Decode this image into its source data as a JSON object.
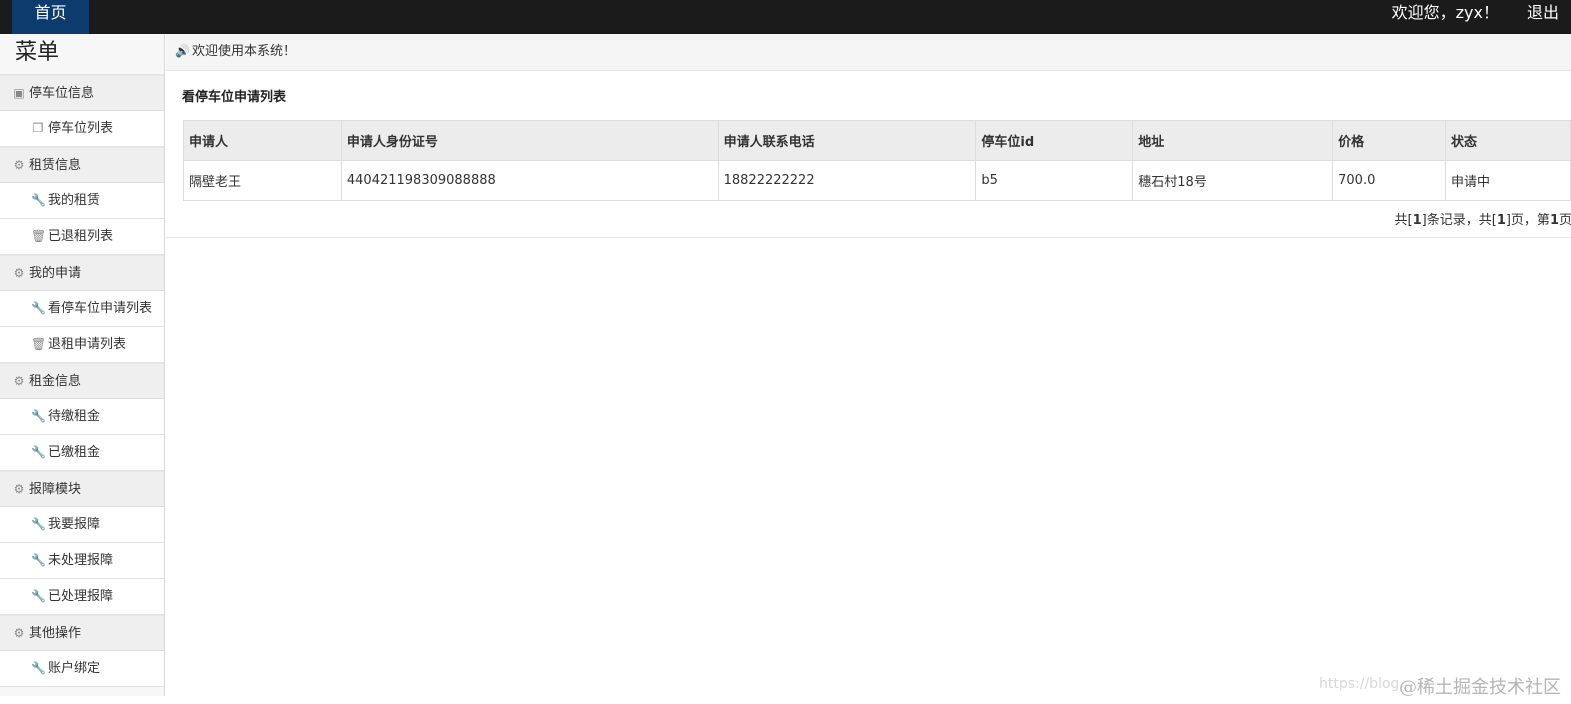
{
  "topbar": {
    "home_label": "首页",
    "welcome_text": "欢迎您，zyx！",
    "logout_label": "退出"
  },
  "sidebar": {
    "title": "菜单",
    "sections": [
      {
        "label": "停车位信息",
        "icon": "book-icon",
        "items": [
          {
            "label": "停车位列表",
            "icon": "file-icon"
          }
        ]
      },
      {
        "label": "租赁信息",
        "icon": "gear-icon",
        "items": [
          {
            "label": "我的租赁",
            "icon": "wrench-icon"
          },
          {
            "label": "已退租列表",
            "icon": "trash-icon"
          }
        ]
      },
      {
        "label": "我的申请",
        "icon": "gear-icon",
        "items": [
          {
            "label": "看停车位申请列表",
            "icon": "wrench-icon"
          },
          {
            "label": "退租申请列表",
            "icon": "trash-icon"
          }
        ]
      },
      {
        "label": "租金信息",
        "icon": "gear-icon",
        "items": [
          {
            "label": "待缴租金",
            "icon": "wrench-icon"
          },
          {
            "label": "已缴租金",
            "icon": "wrench-icon"
          }
        ]
      },
      {
        "label": "报障模块",
        "icon": "gear-icon",
        "items": [
          {
            "label": "我要报障",
            "icon": "wrench-icon"
          },
          {
            "label": "未处理报障",
            "icon": "wrench-icon"
          },
          {
            "label": "已处理报障",
            "icon": "wrench-icon"
          }
        ]
      },
      {
        "label": "其他操作",
        "icon": "gear-icon",
        "items": [
          {
            "label": "账户绑定",
            "icon": "wrench-icon"
          }
        ]
      }
    ]
  },
  "main": {
    "notice": "欢迎使用本系统！",
    "panel_title": "看停车位申请列表",
    "table": {
      "headers": [
        "申请人",
        "申请人身份证号",
        "申请人联系电话",
        "停车位id",
        "地址",
        "价格",
        "状态"
      ],
      "rows": [
        [
          "隔壁老王",
          "440421198309088888",
          "18822222222",
          "b5",
          "穗石村18号",
          "700.0",
          "申请中"
        ]
      ]
    },
    "pager": {
      "p1": "共[",
      "total": "1",
      "p2": "]条记录，共[",
      "pages": "1",
      "p3": "]页，第",
      "current": "1",
      "p4": "页"
    }
  },
  "watermark": {
    "url": "https://blog.",
    "brand": "@稀土掘金技术社区"
  }
}
